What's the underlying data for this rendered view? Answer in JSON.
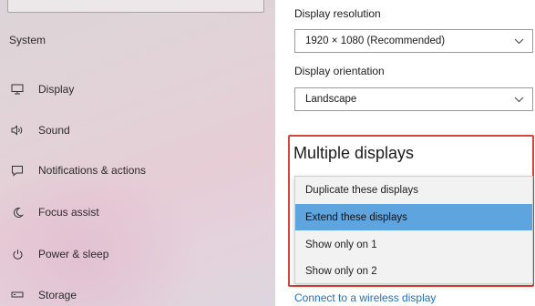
{
  "sidebar": {
    "section_title": "System",
    "items": [
      {
        "label": "Display",
        "icon": "monitor-icon"
      },
      {
        "label": "Sound",
        "icon": "speaker-icon"
      },
      {
        "label": "Notifications & actions",
        "icon": "message-icon"
      },
      {
        "label": "Focus assist",
        "icon": "moon-icon"
      },
      {
        "label": "Power & sleep",
        "icon": "power-icon"
      },
      {
        "label": "Storage",
        "icon": "storage-icon"
      }
    ]
  },
  "main": {
    "resolution": {
      "label": "Display resolution",
      "value": "1920 × 1080 (Recommended)"
    },
    "orientation": {
      "label": "Display orientation",
      "value": "Landscape"
    },
    "multiple_displays": {
      "title": "Multiple displays",
      "highlight_color": "#d6453a",
      "options": [
        "Duplicate these displays",
        "Extend these displays",
        "Show only on 1",
        "Show only on 2"
      ],
      "selected_option": "Extend these displays"
    },
    "link_text": "Connect to a wireless display"
  },
  "colors": {
    "selection": "#5ea4df",
    "link": "#1f6fc6"
  }
}
